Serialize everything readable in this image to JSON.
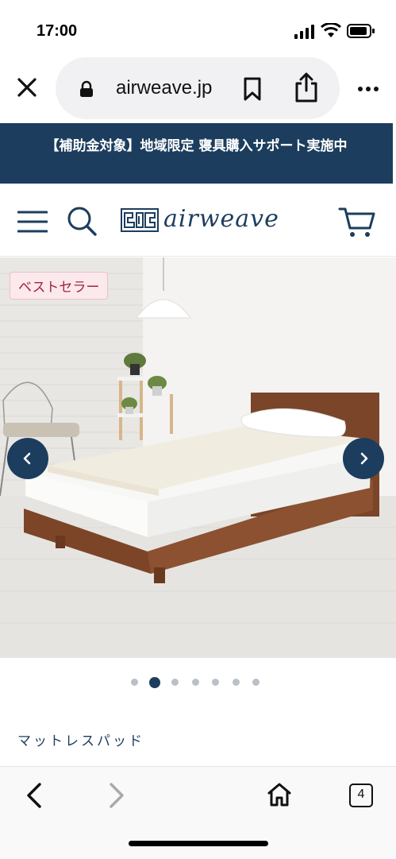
{
  "status_bar": {
    "time": "17:00"
  },
  "browser": {
    "url": "airweave.jp",
    "close_label": "close",
    "tabs_count": "4"
  },
  "banner": {
    "text": "【補助金対象】地域限定 寝具購入サポート実施中"
  },
  "header": {
    "logo_text": "airweave"
  },
  "hero": {
    "badge": "ベストセラー",
    "slide_count": 7,
    "active_slide": 2
  },
  "product": {
    "category": "マットレスパッド"
  },
  "colors": {
    "brand": "#1c3d5e",
    "badge_text": "#a3243f",
    "badge_bg": "#fbe9ec"
  }
}
